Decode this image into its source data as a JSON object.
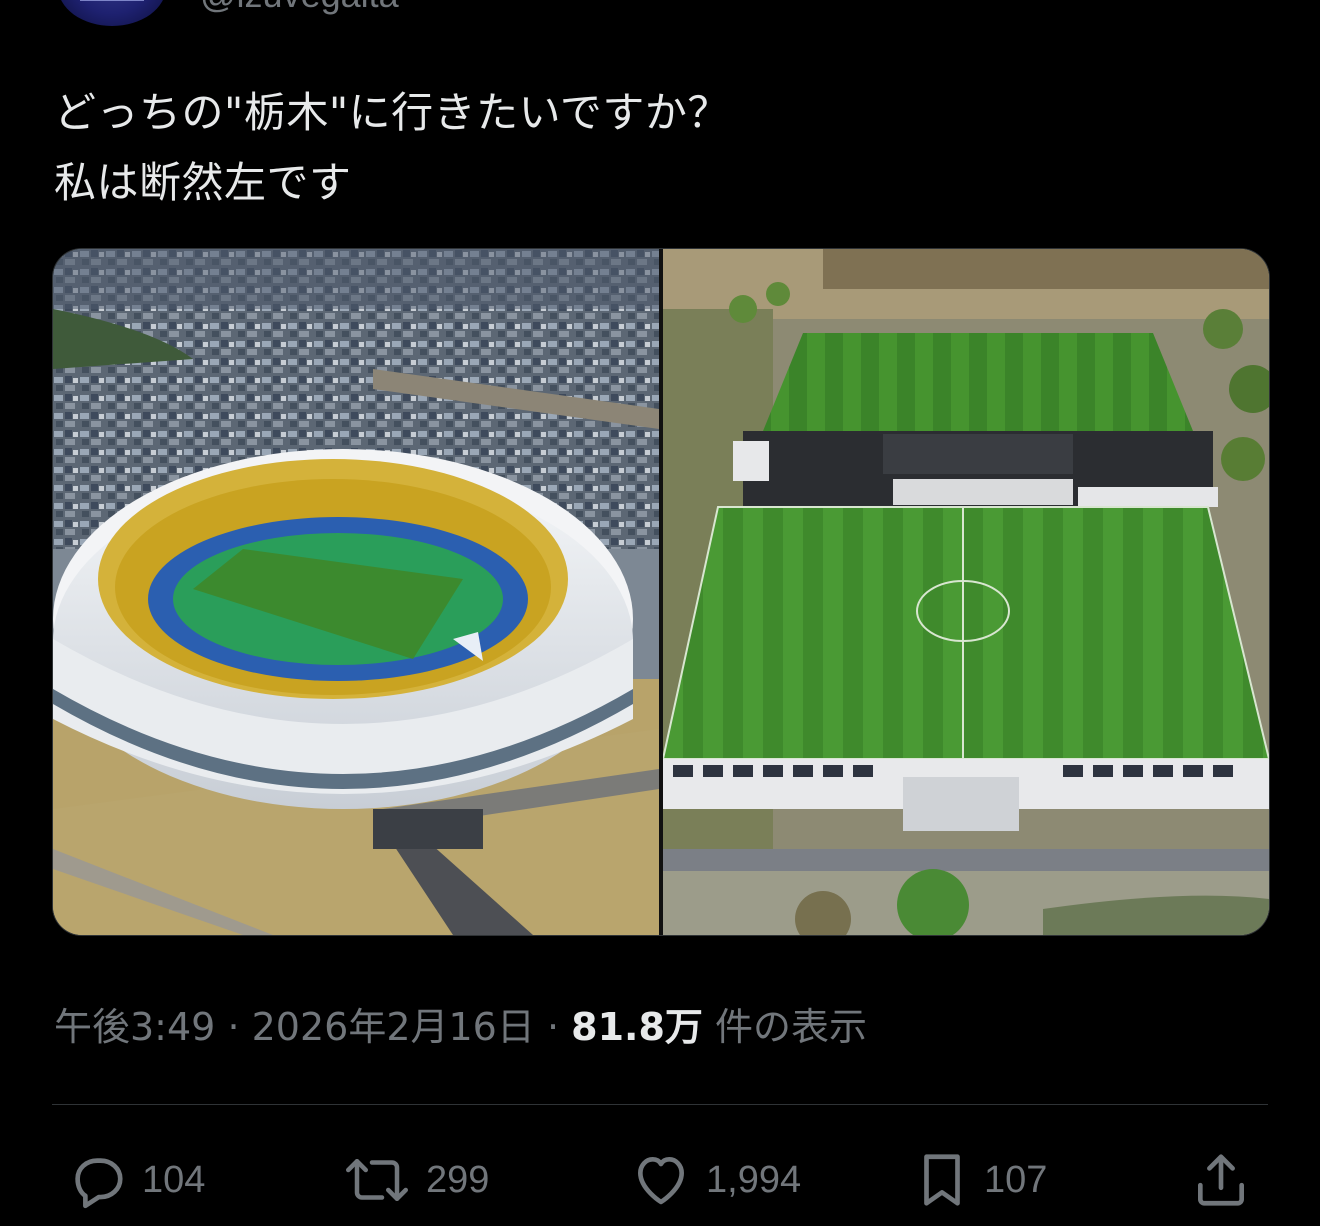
{
  "author": {
    "handle": "@izuvegalta"
  },
  "tweet": {
    "lines": [
      "どっちの\"栃木\"に行きたいですか？",
      "私は断然左です"
    ]
  },
  "meta": {
    "time": "午後3:49",
    "separator": "·",
    "date": "2026年2月16日",
    "views_count": "81.8万",
    "views_label": "件の表示"
  },
  "actions": {
    "reply_count": "104",
    "retweet_count": "299",
    "like_count": "1,994",
    "bookmark_count": "107"
  },
  "colors": {
    "background": "#000000",
    "text": "#e7e9ea",
    "muted": "#71767b",
    "divider": "#2f3336"
  }
}
